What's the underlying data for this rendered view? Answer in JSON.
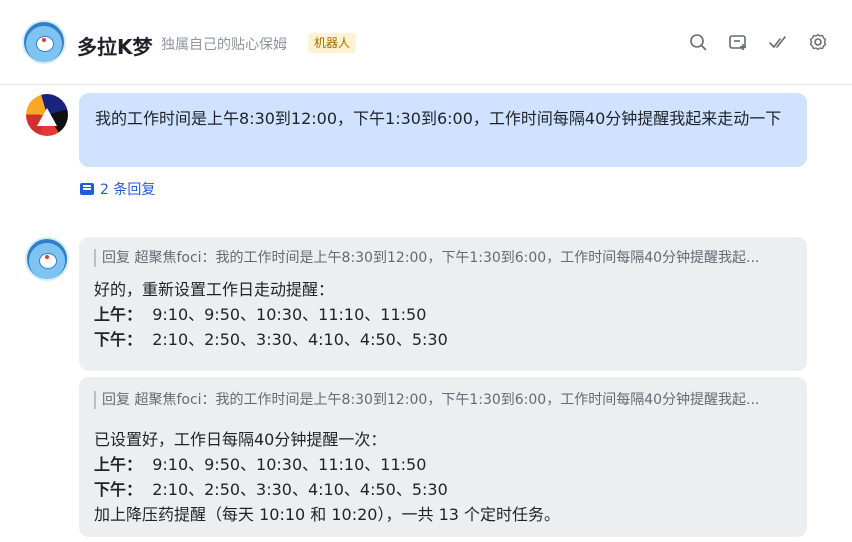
{
  "header": {
    "title": "多拉K梦",
    "subtitle": "独属自己的贴心保姆",
    "badge": "机器人",
    "icons": [
      "search-icon",
      "add-topic-icon",
      "check-icon",
      "gear-icon"
    ]
  },
  "messages": {
    "user_message": "我的工作时间是上午8:30到12:00，下午1:30到6:00，工作时间每隔40分钟提醒我起来走动一下",
    "replies_count": "2 条回复",
    "reply1": {
      "quote": "回复 超聚焦foci：我的工作时间是上午8:30到12:00，下午1:30到6:00，工作时间每隔40分钟提醒我起...",
      "line1": "好的，重新设置工作日走动提醒：",
      "am_label": "上午：",
      "am_times": "9:10、9:50、10:30、11:10、11:50",
      "pm_label": "下午：",
      "pm_times": "2:10、2:50、3:30、4:10、4:50、5:30"
    },
    "reply2": {
      "quote": "回复 超聚焦foci：我的工作时间是上午8:30到12:00，下午1:30到6:00，工作时间每隔40分钟提醒我起...",
      "line1": "已设置好，工作日每隔40分钟提醒一次：",
      "am_label": "上午：",
      "am_times": "9:10、9:50、10:30、11:10、11:50",
      "pm_label": "下午：",
      "pm_times": "2:10、2:50、3:30、4:10、4:50、5:30",
      "line_extra": "加上降压药提醒（每天 10:10 和 10:20），一共 13 个定时任务。"
    }
  },
  "colors": {
    "user_bubble": "#cfe2ff",
    "bot_bubble": "#edeef0",
    "link": "#245bdb",
    "badge_bg": "#fdf3d0",
    "badge_text": "#a86b00"
  }
}
